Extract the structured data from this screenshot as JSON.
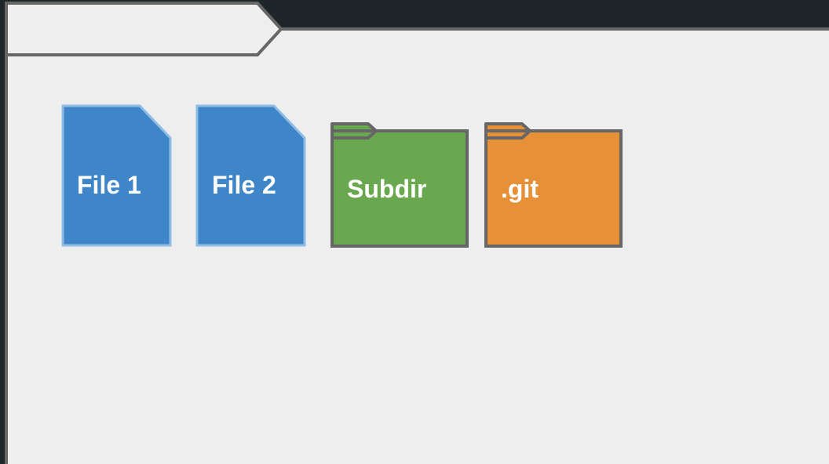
{
  "window": {
    "tab_title": ""
  },
  "items": [
    {
      "kind": "file",
      "label": "File 1",
      "icon": "file-icon",
      "color": "#3e86c8",
      "border": "#8fbce6"
    },
    {
      "kind": "file",
      "label": "File 2",
      "icon": "file-icon",
      "color": "#3e86c8",
      "border": "#8fbce6"
    },
    {
      "kind": "folder",
      "label": "Subdir",
      "icon": "folder-icon",
      "color": "#6aa84f",
      "border": "#666666"
    },
    {
      "kind": "folder",
      "label": ".git",
      "icon": "folder-icon",
      "color": "#e69138",
      "border": "#666666"
    }
  ],
  "colors": {
    "background": "#1f2629",
    "window_fill": "#eeeeee",
    "window_border": "#666666"
  }
}
